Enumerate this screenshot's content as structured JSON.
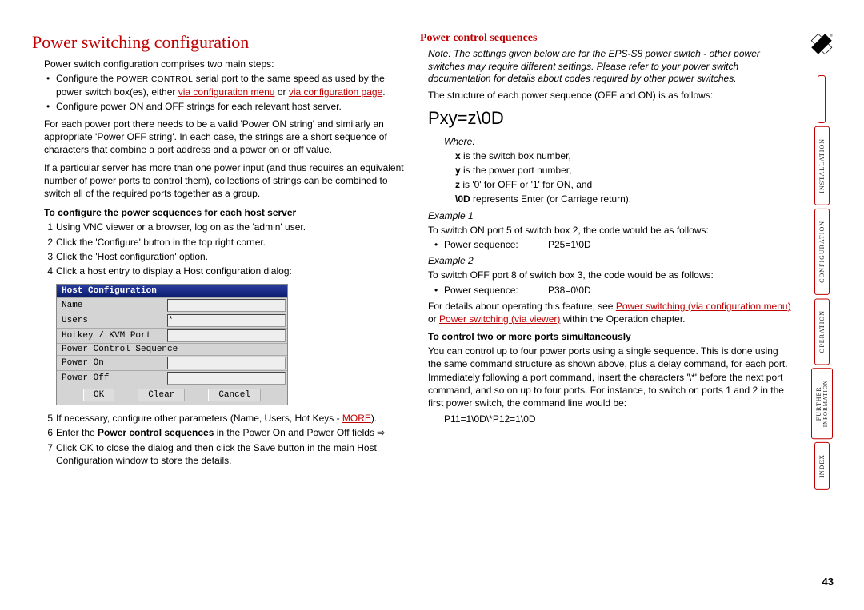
{
  "left": {
    "title": "Power switching configuration",
    "intro": "Power switch configuration comprises two main steps:",
    "bullets": [
      {
        "pre": "Configure the ",
        "caps": "POWER CONTROL",
        "mid": " serial port to the same speed as used by the power switch box(es), either ",
        "link1": "via configuration menu",
        "mid2": " or ",
        "link2": "via configuration page",
        "post": "."
      },
      {
        "text": "Configure power ON and OFF strings for each relevant host server."
      }
    ],
    "para1": "For each power port there needs to be a valid 'Power ON string' and similarly an appropriate 'Power OFF string'. In each case, the strings are a short sequence of characters that combine a port address and a power on or off value.",
    "para2": "If a particular server has more than one power input (and thus requires an equivalent number of power ports to control them), collections of strings can be combined to switch all of the required ports together as a group.",
    "subhead": "To configure the power sequences for each host server",
    "steps": [
      "Using VNC viewer or a browser, log on as the 'admin' user.",
      "Click the 'Configure' button in the top right corner.",
      "Click the 'Host configuration' option.",
      "Click a host entry to display a Host configuration dialog:"
    ],
    "dialog": {
      "title": "Host Configuration",
      "rows": [
        "Name",
        "Users",
        "Hotkey / KVM Port",
        "Power Control Sequence",
        "Power On",
        "Power Off"
      ],
      "users_val": "*",
      "btns": [
        "OK",
        "Clear",
        "Cancel"
      ]
    },
    "steps2": [
      {
        "pre": "If necessary, configure other parameters (Name, Users, Hot Keys - ",
        "link": "MORE",
        "post": ")."
      },
      {
        "pre": "Enter the ",
        "bold": "Power control sequences",
        "post": " in the Power On and Power Off fields"
      },
      {
        "text": "Click OK to close the dialog and then click the Save button in the main Host Configuration window to store the details."
      }
    ]
  },
  "right": {
    "title": "Power control sequences",
    "note": "Note: The settings given below are for the EPS-S8 power switch - other power switches may require different settings. Please refer to your power switch documentation for details about codes required by other power switches.",
    "structure": "The structure of each power sequence (OFF and ON) is as follows:",
    "codebig": "Pxy=z\\0D",
    "where": "Where:",
    "defs": [
      {
        "b": "x",
        "t": " is the switch box number,"
      },
      {
        "b": "y",
        "t": " is the power port number,"
      },
      {
        "b": "z",
        "t": " is '0' for OFF or '1' for ON, and"
      },
      {
        "b": "\\0D",
        "t": " represents Enter (or Carriage return)."
      }
    ],
    "ex1_h": "Example 1",
    "ex1_t": "To switch ON port 5 of switch box 2, the code would be as follows:",
    "ex1_lab": "Power sequence:",
    "ex1_val": "P25=1\\0D",
    "ex2_h": "Example 2",
    "ex2_t": "To switch OFF port 8 of switch box 3, the code would be as follows:",
    "ex2_lab": "Power sequence:",
    "ex2_val": "P38=0\\0D",
    "details_pre": "For details about operating this feature, see ",
    "details_l1": "Power switching (via configuration menu)",
    "details_mid": " or ",
    "details_l2": "Power switching (via viewer)",
    "details_post": " within the Operation chapter.",
    "ctrl_h": "To control two or more ports simultaneously",
    "ctrl_p": "You can control up to four power ports using a single sequence. This is done using the same command structure as shown above, plus a delay command, for each port. Immediately following a port command, insert the characters '\\*' before the next port command, and so on up to four ports. For instance, to switch on ports 1 and 2 in the first power switch, the command line would be:",
    "ctrl_code": "P11=1\\0D\\*P12=1\\0D"
  },
  "sidebar": {
    "tabs": [
      {
        "label": "INSTALLATION"
      },
      {
        "label": "CONFIGURATION"
      },
      {
        "label": "OPERATION"
      },
      {
        "label": "FURTHER",
        "sub": "INFORMATION"
      },
      {
        "label": "INDEX"
      }
    ]
  },
  "pagenum": "43"
}
